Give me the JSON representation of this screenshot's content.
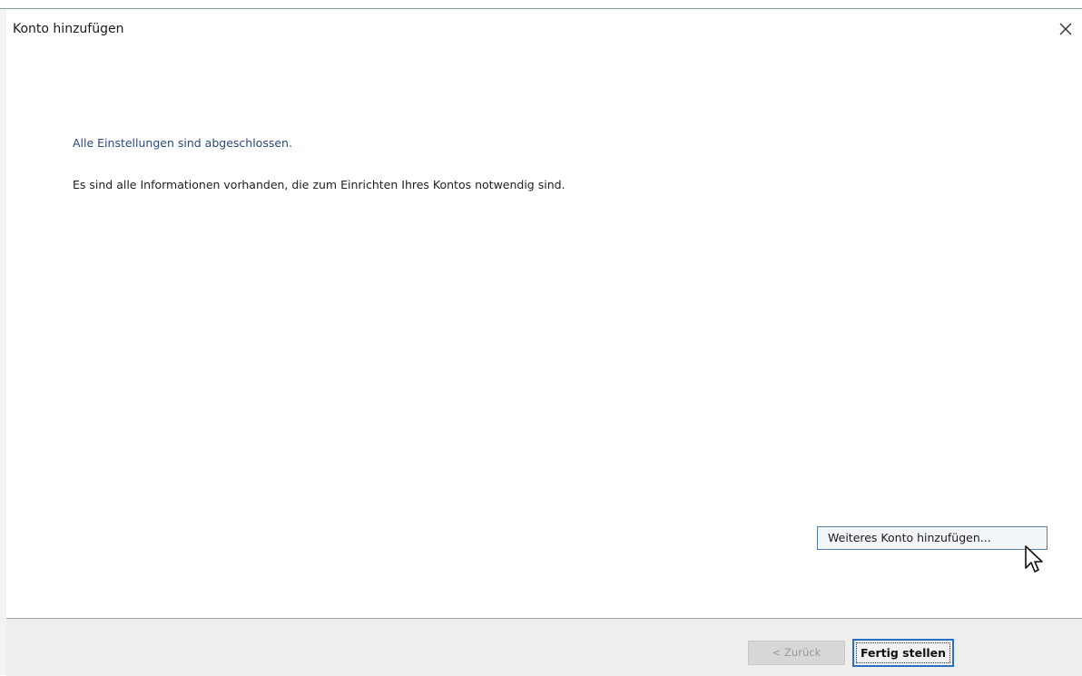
{
  "window": {
    "title": "Konto hinzufügen",
    "close_icon": "close-icon"
  },
  "content": {
    "heading": "Alle Einstellungen sind abgeschlossen.",
    "info": "Es sind alle Informationen vorhanden, die zum Einrichten Ihres Kontos notwendig sind.",
    "add_account_label": "Weiteres Konto hinzufügen...",
    "cursor_icon": "mouse-pointer-icon"
  },
  "footer": {
    "back_label": "< Zurück",
    "finish_label": "Fertig stellen"
  },
  "colors": {
    "heading": "#2b4a7a",
    "focus_accent": "#2a6fc0",
    "footer_bg": "#eeeeee"
  }
}
